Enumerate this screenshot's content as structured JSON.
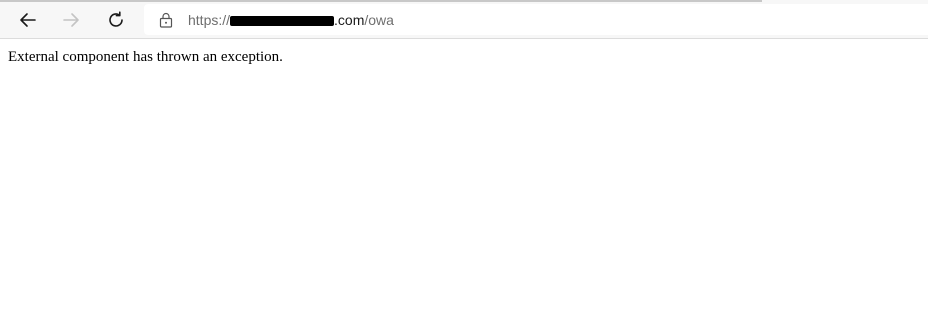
{
  "browser": {
    "url": {
      "scheme": "https://",
      "redacted_host": "",
      "domain_suffix": ".com",
      "path": "/owa"
    },
    "icons": {
      "back": "back-arrow-icon",
      "forward": "forward-arrow-icon",
      "reload": "reload-icon",
      "lock": "lock-icon"
    },
    "colors": {
      "toolbar_bg": "#f7f7f7",
      "address_bg": "#ffffff",
      "redaction": "#000000"
    }
  },
  "page": {
    "error_message": "External component has thrown an exception."
  }
}
